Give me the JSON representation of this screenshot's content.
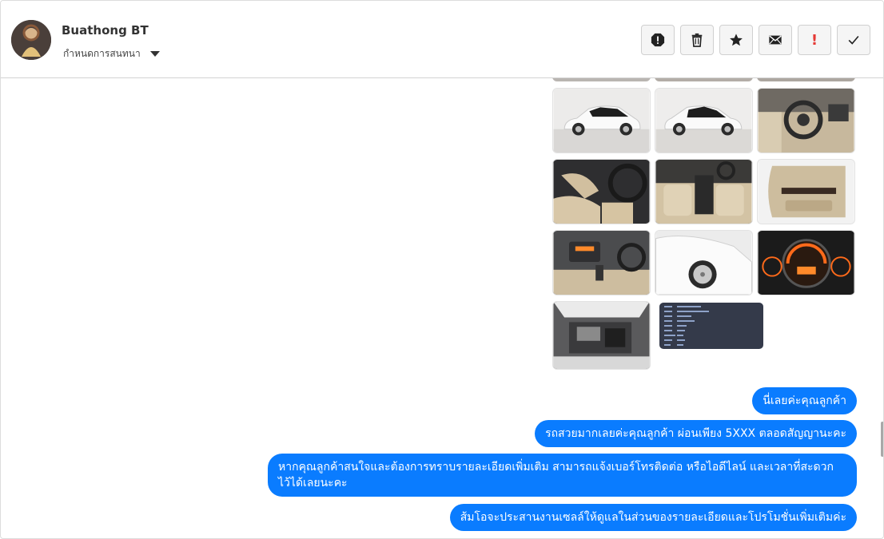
{
  "header": {
    "contact_name": "Buathong BT",
    "assign_label": "กำหนดการสนทนา",
    "actions": [
      {
        "name": "report-icon"
      },
      {
        "name": "trash-icon"
      },
      {
        "name": "star-icon"
      },
      {
        "name": "mail-icon"
      },
      {
        "name": "priority-icon",
        "glyph": "!"
      },
      {
        "name": "check-icon"
      }
    ]
  },
  "images": [
    {
      "name": "car-exterior-side-left-photo"
    },
    {
      "name": "car-exterior-side-right-photo"
    },
    {
      "name": "car-dashboard-photo"
    },
    {
      "name": "car-front-seat-photo"
    },
    {
      "name": "car-interior-cabin-photo"
    },
    {
      "name": "car-door-panel-photo"
    },
    {
      "name": "car-radio-console-photo"
    },
    {
      "name": "car-front-wheel-photo"
    },
    {
      "name": "car-gauge-cluster-photo"
    },
    {
      "name": "car-engine-bay-photo"
    },
    {
      "name": "car-spec-sheet-image"
    }
  ],
  "messages": [
    {
      "text": "นี่เลยค่ะคุณลูกค้า"
    },
    {
      "text": "รถสวยมากเลยค่ะคุณลูกค้า ผ่อนเพียง 5XXX  ตลอดสัญญานะคะ"
    },
    {
      "text": "หากคุณลูกค้าสนใจและต้องการทราบรายละเอียดเพิ่มเติม สามารถแจ้งเบอร์โทรติดต่อ หรือไอดีไลน์ และเวลาที่สะดวก ไว้ได้เลยนะคะ"
    },
    {
      "text": "ส้มโอจะประสานงานเซลล์ให้ดูแลในส่วนของรายละเอียดและโปรโมชั่นเพิ่มเติมค่ะ"
    }
  ]
}
